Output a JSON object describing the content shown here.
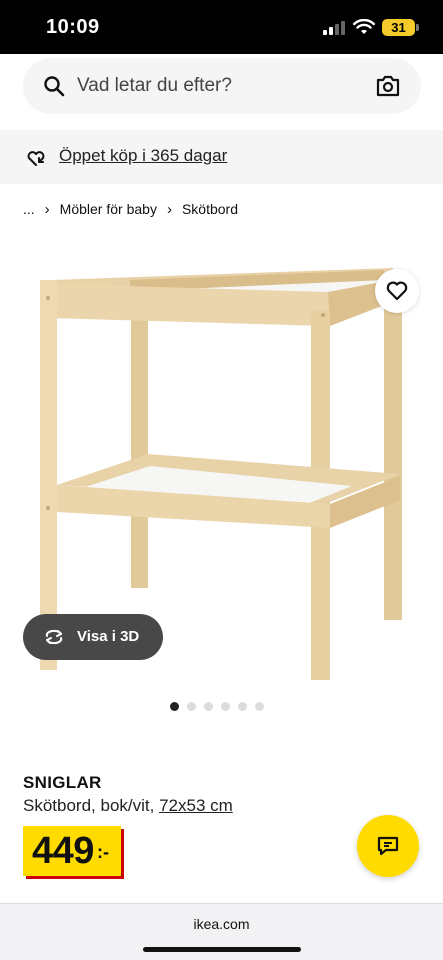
{
  "status_bar": {
    "time": "10:09",
    "battery": "31"
  },
  "search": {
    "placeholder": "Vad letar du efter?",
    "search_icon": "search-icon",
    "camera_icon": "camera-icon"
  },
  "promo": {
    "icon": "return-arrows-icon",
    "text": "Öppet köp i 365 dagar"
  },
  "breadcrumb": {
    "items": [
      "...",
      "Möbler för baby",
      "Skötbord"
    ]
  },
  "gallery": {
    "view3d_label": "Visa i 3D",
    "slide_count": 6,
    "active_slide": 1
  },
  "product": {
    "name": "SNIGLAR",
    "description": "Skötbord, bok/vit, ",
    "dimensions": "72x53 cm",
    "price_integer": "449",
    "price_decimal": ":-"
  },
  "browser": {
    "url": "ikea.com"
  },
  "colors": {
    "ikea_yellow": "#ffdb00",
    "price_shadow": "#cc0008",
    "wood": "#e9d3a8"
  }
}
